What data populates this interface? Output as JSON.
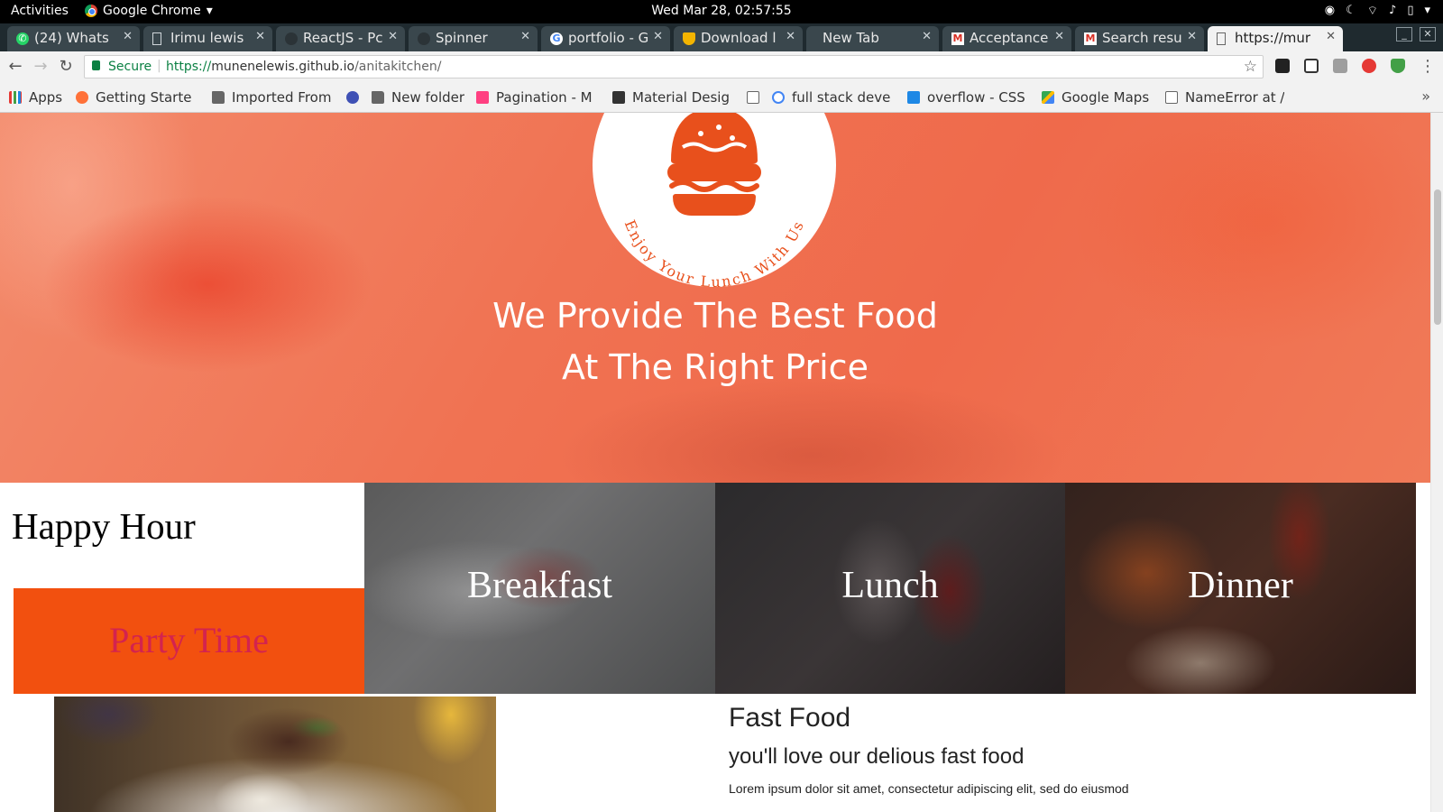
{
  "system_bar": {
    "activities": "Activities",
    "app_name": "Google Chrome",
    "clock": "Wed Mar 28, 02:57:55"
  },
  "tabs": [
    {
      "label": "(24) Whats",
      "favicon": "whatsapp-icon",
      "active": false
    },
    {
      "label": "Irimu lewis",
      "favicon": "document-icon",
      "active": false
    },
    {
      "label": "ReactJS - Pc",
      "favicon": "github-icon",
      "active": false
    },
    {
      "label": "Spinner",
      "favicon": "github-icon",
      "active": false
    },
    {
      "label": "portfolio - G",
      "favicon": "google-icon",
      "active": false
    },
    {
      "label": "Download l",
      "favicon": "shield-icon",
      "active": false
    },
    {
      "label": "New Tab",
      "favicon": "",
      "active": false
    },
    {
      "label": "Acceptance",
      "favicon": "gmail-icon",
      "active": false
    },
    {
      "label": "Search resu",
      "favicon": "gmail-icon",
      "active": false
    },
    {
      "label": "https://mur",
      "favicon": "document-icon",
      "active": true
    }
  ],
  "omnibox": {
    "secure_label": "Secure",
    "url_scheme": "https://",
    "url_host": "munenelewis.github.io",
    "url_path": "/anitakitchen/"
  },
  "bookmarks": [
    {
      "label": "Apps",
      "icon": "apps-grid-icon"
    },
    {
      "label": "Getting Starte",
      "icon": "firefox-icon"
    },
    {
      "label": "Imported From",
      "icon": "folder-icon"
    },
    {
      "label": "",
      "icon": "d-circle-icon"
    },
    {
      "label": "New folder",
      "icon": "folder-icon"
    },
    {
      "label": "Pagination - M",
      "icon": "m-logo-icon"
    },
    {
      "label": "Material Desig",
      "icon": "m-box-icon"
    },
    {
      "label": "",
      "icon": "document-icon"
    },
    {
      "label": "full stack deve",
      "icon": "google-icon"
    },
    {
      "label": "overflow - CSS",
      "icon": "stackoverflow-icon"
    },
    {
      "label": "Google Maps",
      "icon": "maps-icon"
    },
    {
      "label": "NameError at /",
      "icon": "document-icon"
    }
  ],
  "hero": {
    "logo_text": "Enjoy Your Lunch With Us",
    "headline_line1": "We Provide The Best Food",
    "headline_line2": "At The Right Price"
  },
  "happy_hour": {
    "title": "Happy Hour",
    "party_label": "Party Time"
  },
  "meals": [
    "Breakfast",
    "Lunch",
    "Dinner"
  ],
  "fast_food": {
    "title": "Fast Food",
    "subtitle": "you'll love our delious fast food",
    "body": "Lorem ipsum dolor sit amet, consectetur adipiscing elit, sed do eiusmod"
  },
  "colors": {
    "accent_orange": "#f2500f",
    "party_text": "#d3234f",
    "burger_orange": "#e8501c"
  }
}
